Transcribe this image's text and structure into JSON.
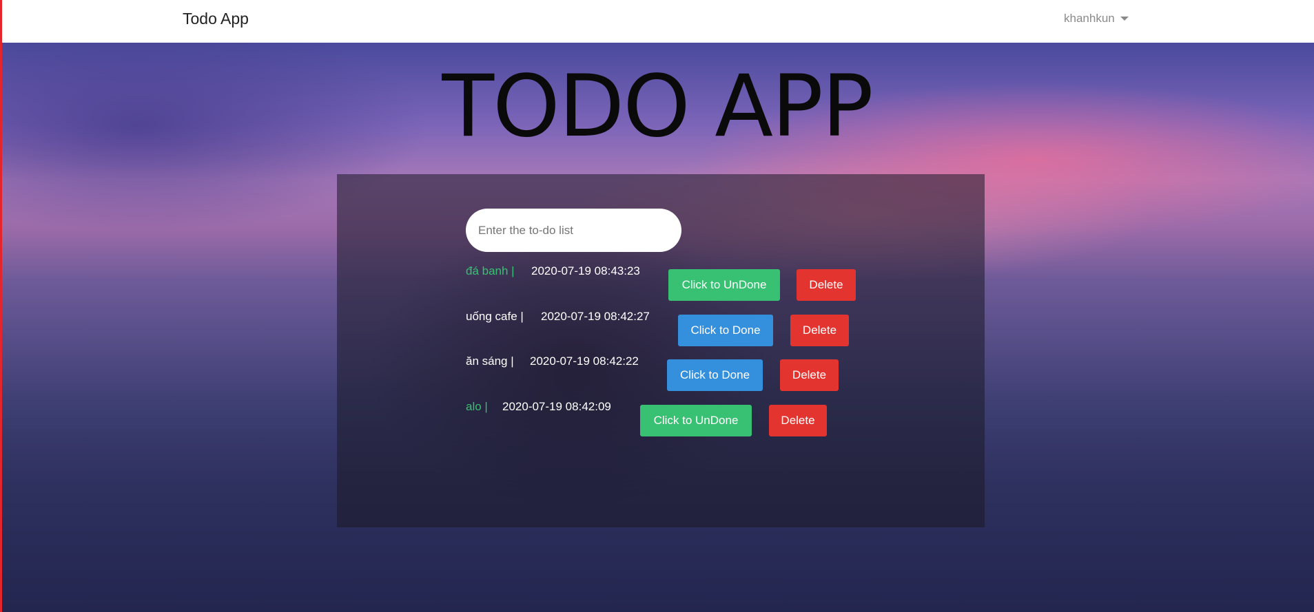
{
  "navbar": {
    "brand": "Todo App",
    "user": "khanhkun"
  },
  "hero": {
    "title": "TODO APP"
  },
  "input": {
    "placeholder": "Enter the to-do list",
    "value": ""
  },
  "todos": [
    {
      "name": "đá banh |",
      "time": "2020-07-19 08:43:23",
      "status": "done",
      "toggle_label": "Click to UnDone",
      "delete_label": "Delete"
    },
    {
      "name": "uống cafe |",
      "time": "2020-07-19 08:42:27",
      "status": "undone",
      "toggle_label": "Click to Done",
      "delete_label": "Delete"
    },
    {
      "name": "ăn sáng |",
      "time": "2020-07-19 08:42:22",
      "status": "undone",
      "toggle_label": "Click to Done",
      "delete_label": "Delete"
    },
    {
      "name": "alo |",
      "time": "2020-07-19 08:42:09",
      "status": "done",
      "toggle_label": "Click to UnDone",
      "delete_label": "Delete"
    }
  ],
  "colors": {
    "done_text": "#38c172",
    "done_button": "#38c172",
    "undone_button": "#3490dc",
    "delete_button": "#e3342f"
  }
}
